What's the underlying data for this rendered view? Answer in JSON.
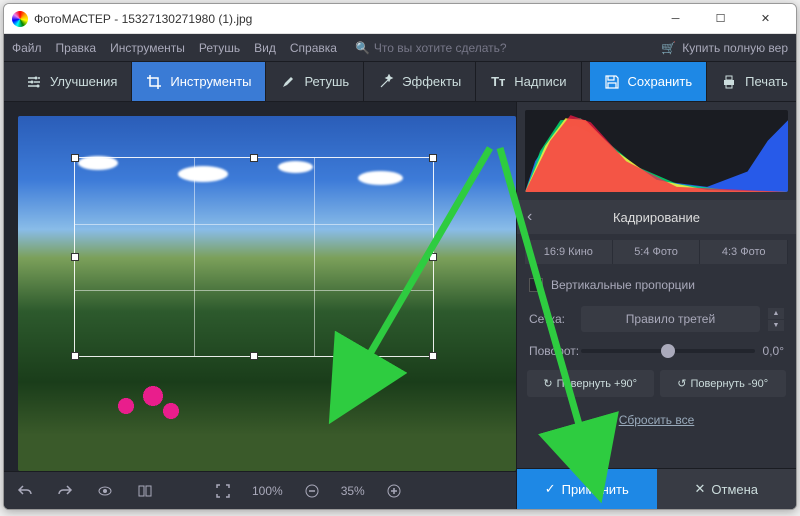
{
  "window": {
    "title": "ФотоМАСТЕР - 15327130271980 (1).jpg"
  },
  "menu": {
    "items": [
      "Файл",
      "Правка",
      "Инструменты",
      "Ретушь",
      "Вид",
      "Справка"
    ],
    "search_placeholder": "Что вы хотите сделать?",
    "buy": "Купить полную вер"
  },
  "tabs": {
    "enhance": "Улучшения",
    "tools": "Инструменты",
    "retouch": "Ретушь",
    "effects": "Эффекты",
    "text": "Надписи",
    "save": "Сохранить",
    "print": "Печать"
  },
  "toolbar": {
    "zoom_fit": "100%",
    "zoom_current": "35%"
  },
  "panel": {
    "title": "Кадрирование",
    "ratios": [
      "16:9 Кино",
      "5:4 Фото",
      "4:3 Фото"
    ],
    "vertical_prop": "Вертикальные пропорции",
    "grid_label": "Сетка:",
    "grid_value": "Правило третей",
    "rotate_label": "Поворот:",
    "rotate_value": "0,0°",
    "rotate_plus": "Повернуть +90°",
    "rotate_minus": "Повернуть -90°",
    "reset": "Сбросить все",
    "apply": "Применить",
    "cancel": "Отмена"
  }
}
